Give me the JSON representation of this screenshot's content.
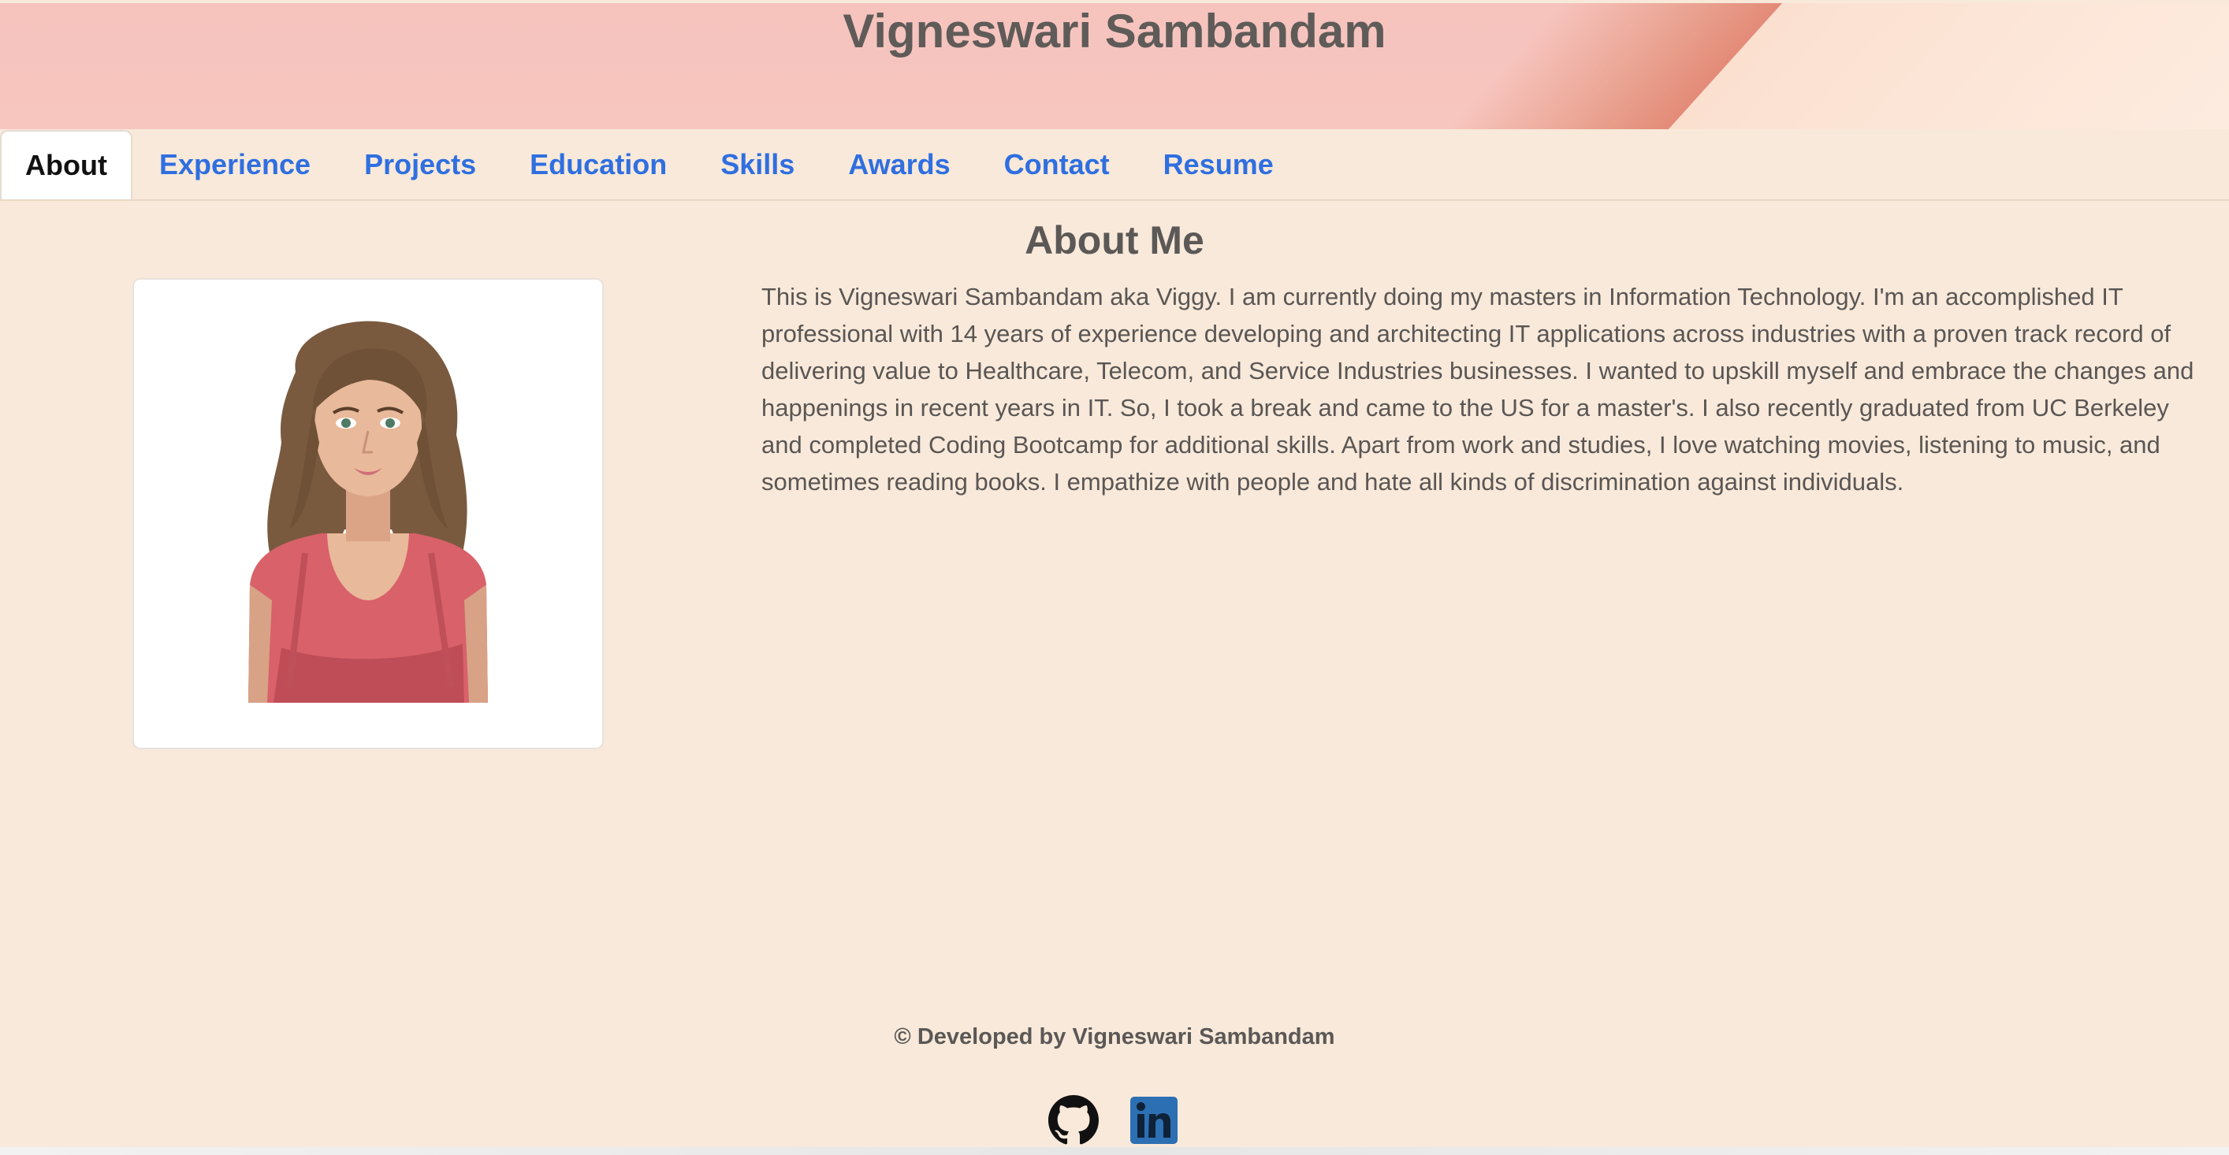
{
  "header": {
    "title": "Vigneswari Sambandam"
  },
  "tabs": [
    {
      "label": "About",
      "active": true
    },
    {
      "label": "Experience"
    },
    {
      "label": "Projects"
    },
    {
      "label": "Education"
    },
    {
      "label": "Skills"
    },
    {
      "label": "Awards"
    },
    {
      "label": "Contact"
    },
    {
      "label": "Resume"
    }
  ],
  "about": {
    "heading": "About Me",
    "avatar_icon": "woman-avatar-illustration",
    "text": "This is Vigneswari Sambandam aka Viggy. I am currently doing my masters in Information Technology. I'm an accomplished IT professional with 14 years of experience developing and architecting IT applications across industries with a proven track record of delivering value to Healthcare, Telecom, and Service Industries businesses. I wanted to upskill myself and embrace the changes and happenings in recent years in IT. So, I took a break and came to the US for a master's. I also recently graduated from UC Berkeley and completed Coding Bootcamp for additional skills. Apart from work and studies, I love watching movies, listening to music, and sometimes reading books. I empathize with people and hate all kinds of discrimination against individuals."
  },
  "footer": {
    "credit": "© Developed by Vigneswari Sambandam",
    "social": [
      {
        "icon": "github-icon"
      },
      {
        "icon": "linkedin-icon"
      }
    ]
  },
  "colors": {
    "background": "#f8e9da",
    "link": "#2f6fe0",
    "text": "#5a5654",
    "header": "#f6c3bd",
    "linkedin": "#2d6fb3"
  }
}
